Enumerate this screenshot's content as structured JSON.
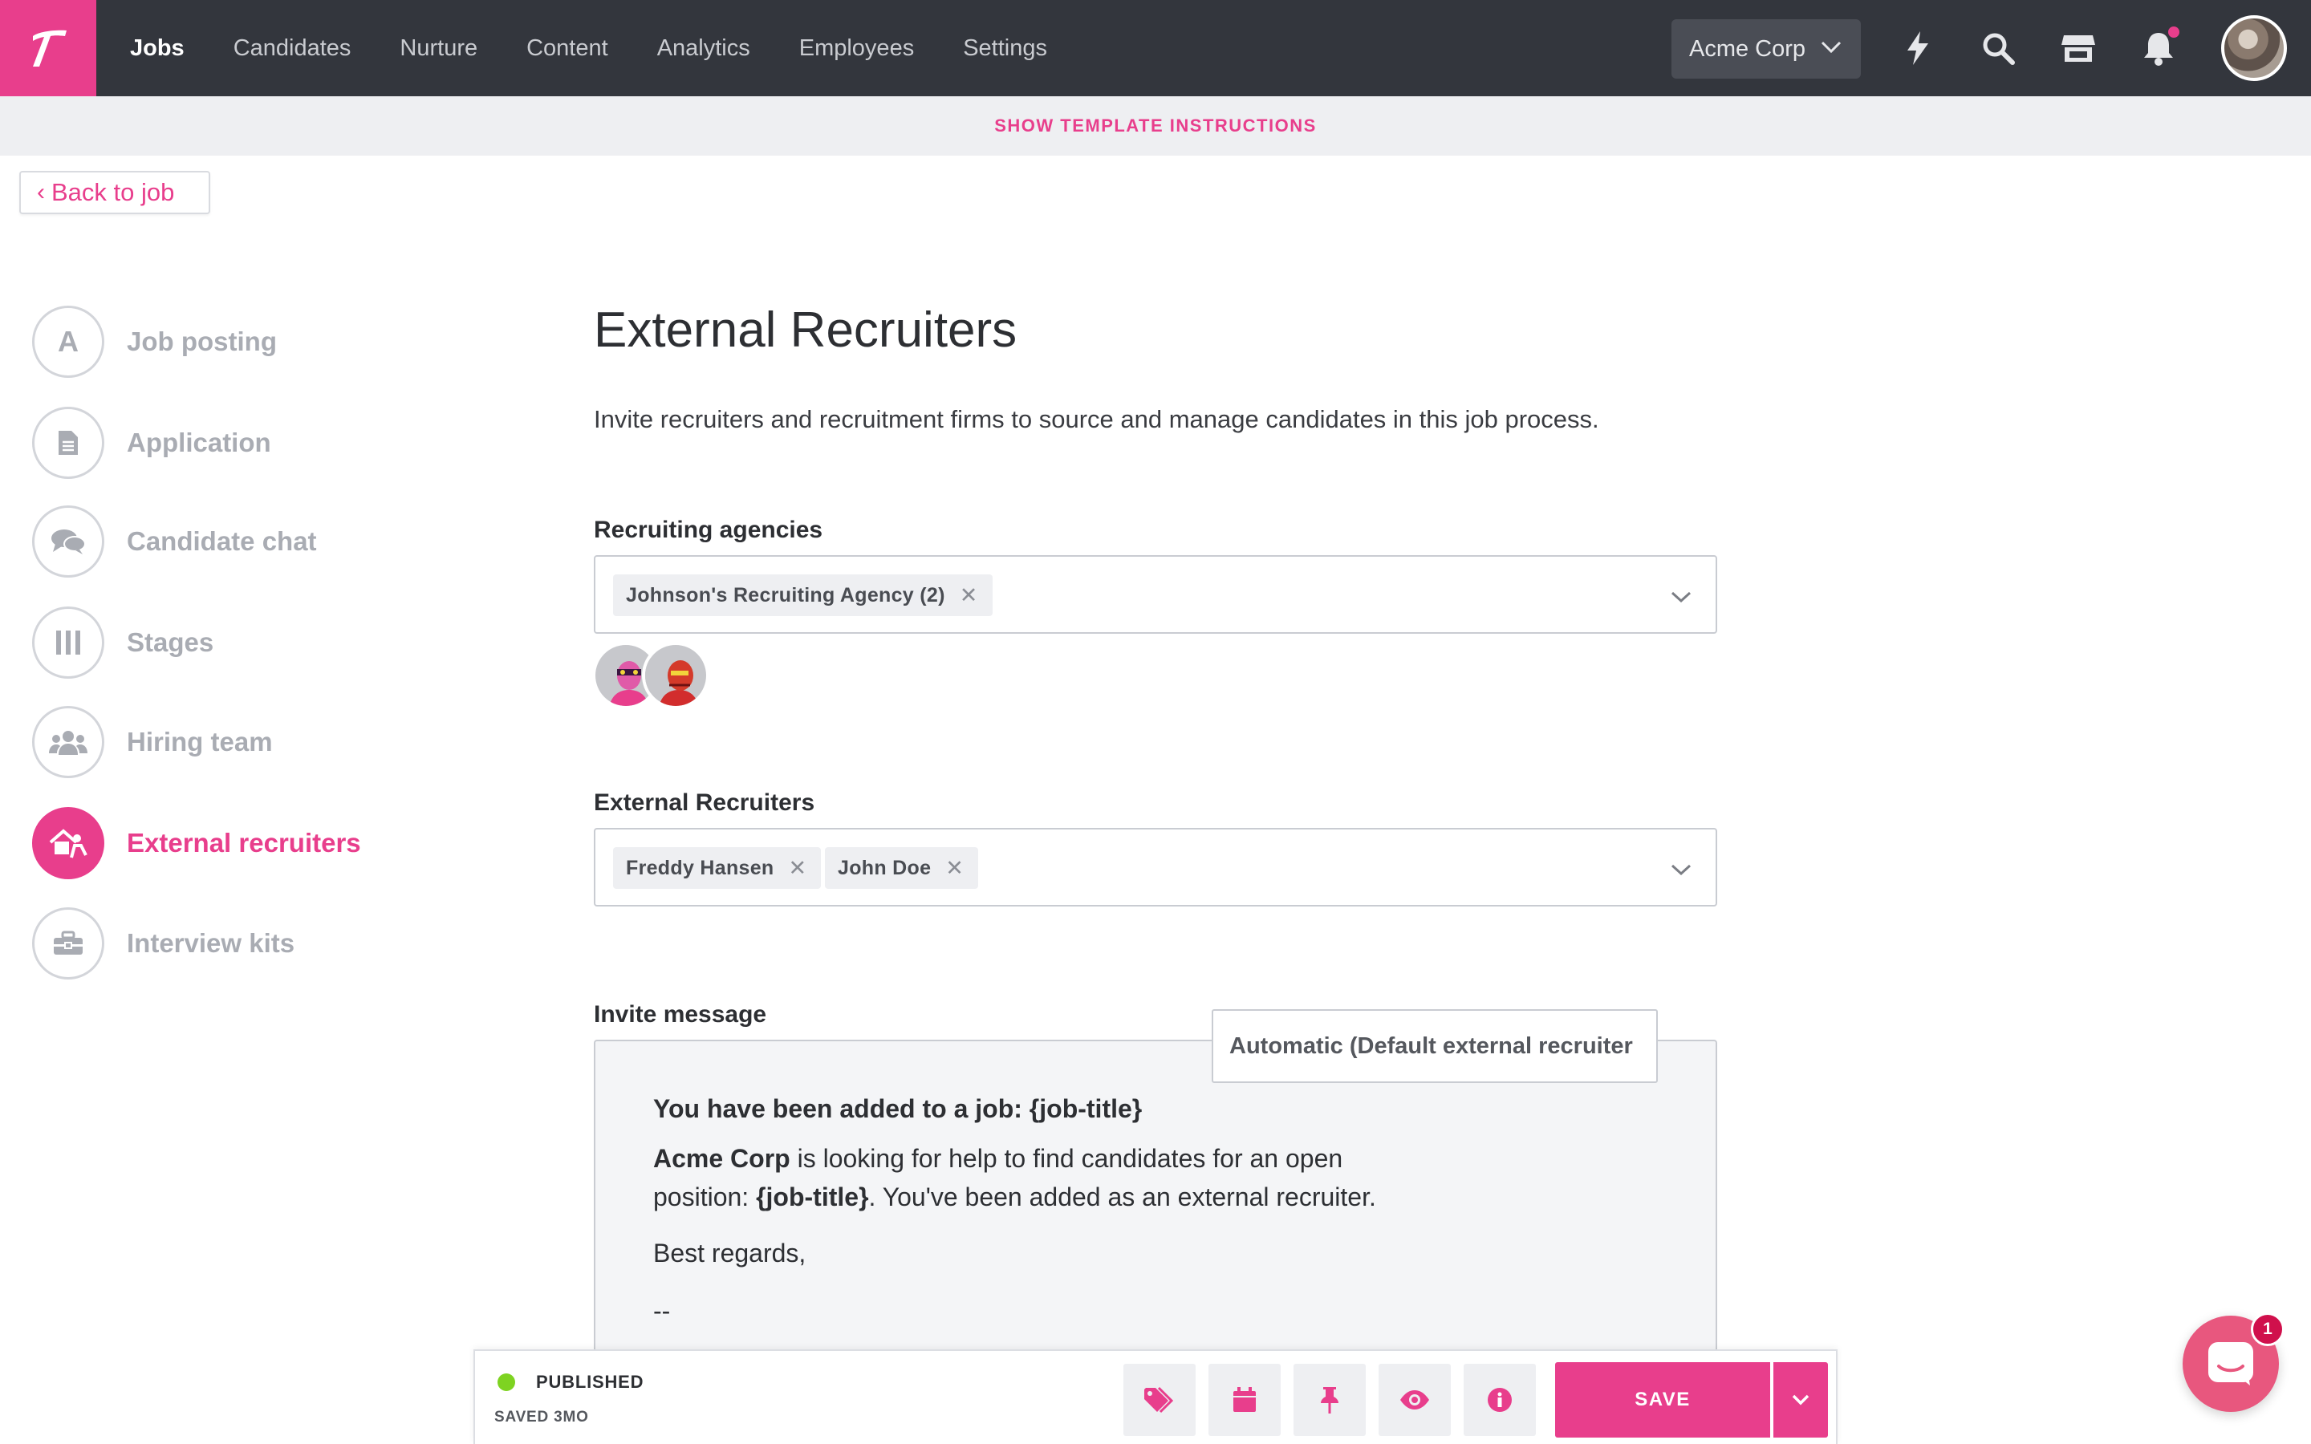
{
  "nav": {
    "logo_icon": "brand-logo-icon",
    "links": [
      "Jobs",
      "Candidates",
      "Nurture",
      "Content",
      "Analytics",
      "Employees",
      "Settings"
    ],
    "company": "Acme Corp",
    "icons": [
      "lightning-icon",
      "search-icon",
      "store-icon",
      "bell-icon"
    ],
    "accent": "#e83e8c",
    "bar_color": "#33363d"
  },
  "instructions_label": "SHOW TEMPLATE INSTRUCTIONS",
  "back_label": "Back to job",
  "steps": [
    {
      "label": "Job posting",
      "icon": "letter-a-icon"
    },
    {
      "label": "Application",
      "icon": "document-icon"
    },
    {
      "label": "Candidate chat",
      "icon": "chat-bubbles-icon"
    },
    {
      "label": "Stages",
      "icon": "stages-columns-icon"
    },
    {
      "label": "Hiring team",
      "icon": "team-icon"
    },
    {
      "label": "External recruiters",
      "icon": "external-recruiter-icon",
      "active": true
    },
    {
      "label": "Interview kits",
      "icon": "toolbox-icon"
    }
  ],
  "page": {
    "title": "External Recruiters",
    "description": "Invite recruiters and recruitment firms to source and manage candidates in this job process."
  },
  "agencies": {
    "label": "Recruiting agencies",
    "chips": [
      "Johnson's Recruiting Agency (2)"
    ]
  },
  "recruiters": {
    "label": "External Recruiters",
    "chips": [
      "Freddy Hansen",
      "John Doe"
    ]
  },
  "invite": {
    "label": "Invite message",
    "template": "Automatic (Default external recruiter",
    "title": "You have been added to a job: {job-title}",
    "company": "Acme Corp",
    "body_1": " is looking for help to find candidates for an open position: ",
    "job_token": "{job-title}",
    "body_2": ". You've been added as an external recruiter.",
    "regards": "Best regards,",
    "signature": "--"
  },
  "actionbar": {
    "status": "PUBLISHED",
    "saved": "SAVED 3MO",
    "status_color": "#7ed321",
    "icons": [
      "tag-icon",
      "calendar-icon",
      "pin-icon",
      "eye-icon",
      "info-icon"
    ],
    "save": "SAVE"
  },
  "chat": {
    "badge": "1"
  }
}
